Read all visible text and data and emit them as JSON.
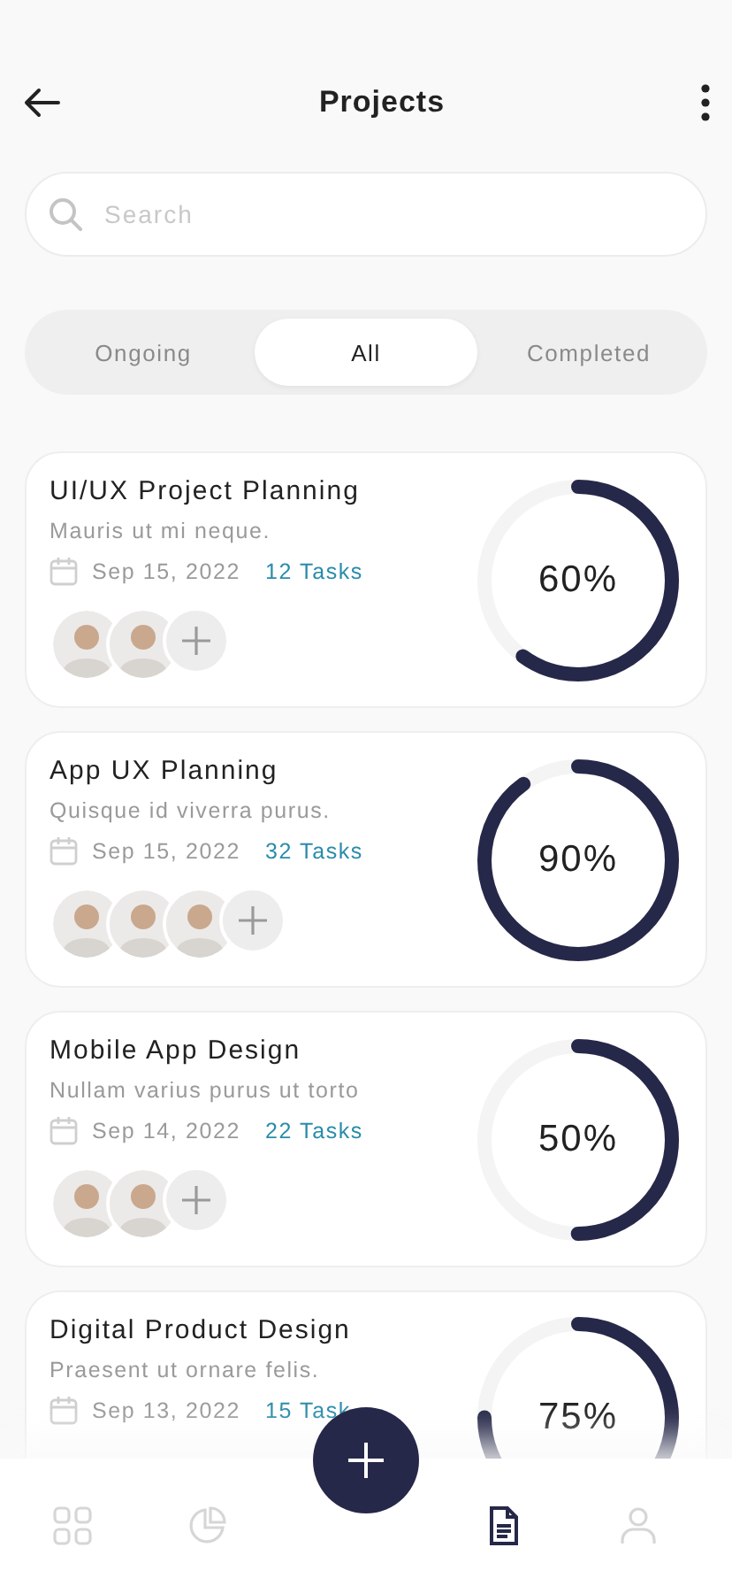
{
  "header": {
    "title": "Projects"
  },
  "search": {
    "placeholder": "Search"
  },
  "tabs": [
    {
      "label": "Ongoing",
      "selected": false
    },
    {
      "label": "All",
      "selected": true
    },
    {
      "label": "Completed",
      "selected": false
    }
  ],
  "projects": [
    {
      "title": "UI/UX Project Planning",
      "description": "Mauris ut mi neque.",
      "date": "Sep 15, 2022",
      "tasks": "12 Tasks",
      "percent": "60%",
      "members": [
        {
          "kind": "avatar"
        },
        {
          "kind": "avatar"
        },
        {
          "kind": "add"
        }
      ]
    },
    {
      "title": "App UX Planning",
      "description": "Quisque id viverra purus.",
      "date": "Sep 15, 2022",
      "tasks": "32 Tasks",
      "percent": "90%",
      "members": [
        {
          "kind": "avatar"
        },
        {
          "kind": "avatar"
        },
        {
          "kind": "avatar"
        },
        {
          "kind": "add"
        }
      ]
    },
    {
      "title": "Mobile App Design",
      "description": "Nullam varius purus ut torto",
      "date": "Sep 14, 2022",
      "tasks": "22 Tasks",
      "percent": "50%",
      "members": [
        {
          "kind": "avatar"
        },
        {
          "kind": "avatar"
        },
        {
          "kind": "add"
        }
      ]
    },
    {
      "title": "Digital Product Design",
      "description": "Praesent ut ornare felis.",
      "date": "Sep 13, 2022",
      "tasks": "15 Task",
      "percent": "75%"
    }
  ],
  "nav": [
    {
      "kind": "grid",
      "selected": false
    },
    {
      "kind": "chart",
      "selected": false
    },
    {
      "kind": "document",
      "selected": true
    },
    {
      "kind": "profile",
      "selected": false
    }
  ]
}
